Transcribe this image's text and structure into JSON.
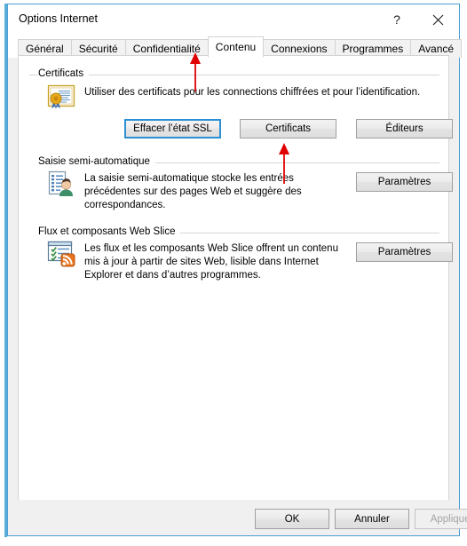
{
  "window": {
    "title": "Options Internet",
    "help_label": "?",
    "close_label": "✕",
    "accent_color": "#4a9fd4"
  },
  "tabs": [
    {
      "label": "Général",
      "active": false
    },
    {
      "label": "Sécurité",
      "active": false
    },
    {
      "label": "Confidentialité",
      "active": false
    },
    {
      "label": "Contenu",
      "active": true
    },
    {
      "label": "Connexions",
      "active": false
    },
    {
      "label": "Programmes",
      "active": false
    },
    {
      "label": "Avancé",
      "active": false
    }
  ],
  "groups": {
    "certificates": {
      "title": "Certificats",
      "icon": "certificate-icon",
      "description": "Utiliser des certificats pour les connections chiffrées et pour l’identification.",
      "buttons": [
        {
          "label": "Effacer l’état SSL",
          "focused": true
        },
        {
          "label": "Certificats",
          "focused": false
        },
        {
          "label": "Éditeurs",
          "focused": false
        }
      ]
    },
    "autocomplete": {
      "title": "Saisie semi-automatique",
      "icon": "autocomplete-icon",
      "description": "La saisie semi-automatique stocke les entrées précédentes sur des pages Web et suggère des correspondances.",
      "button": {
        "label": "Paramètres"
      }
    },
    "webslice": {
      "title": "Flux et composants Web Slice",
      "icon": "feed-icon",
      "description": "Les flux et les composants Web Slice offrent un contenu mis à jour à partir de sites Web, lisible dans Internet Explorer et dans d’autres programmes.",
      "button": {
        "label": "Paramètres"
      }
    }
  },
  "footer": {
    "ok_label": "OK",
    "cancel_label": "Annuler",
    "apply_label": "Appliquer",
    "apply_disabled": true
  },
  "annotations": {
    "color": "#e00000",
    "arrows": [
      {
        "name": "arrow-to-contenu-tab",
        "target": "Contenu"
      },
      {
        "name": "arrow-to-certificats-button",
        "target": "Certificats"
      }
    ]
  }
}
